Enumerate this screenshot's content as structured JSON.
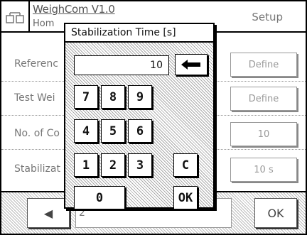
{
  "header": {
    "app_title": "WeighCom V1.0",
    "app_subtitle": "Hom",
    "section": "Setup"
  },
  "rows": [
    {
      "label": "Referenc",
      "value": "Define"
    },
    {
      "label": "Test Wei",
      "value": "Define"
    },
    {
      "label": "No. of Co",
      "value": "10"
    },
    {
      "label": "Stabilizat",
      "value": "10 s"
    }
  ],
  "bottom": {
    "left_icon": "left-arrow-icon",
    "middle_text": "2",
    "ok_label": "OK"
  },
  "dialog": {
    "title": "Stabilization Time [s]",
    "display_value": "10",
    "backspace_icon": "backspace-arrow-icon",
    "keys": {
      "k7": "7",
      "k8": "8",
      "k9": "9",
      "k4": "4",
      "k5": "5",
      "k6": "6",
      "k1": "1",
      "k2": "2",
      "k3": "3",
      "clear": "C",
      "k0": "0",
      "ok": "OK"
    }
  }
}
